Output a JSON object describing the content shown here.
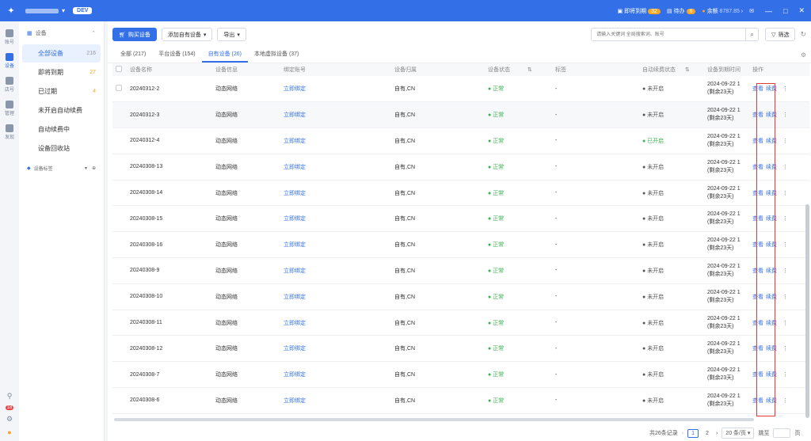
{
  "topbar": {
    "env_badge": "DEV",
    "expiring_label": "即将到期",
    "expiring_count": "32",
    "todo_label": "待办",
    "todo_count": "6",
    "balance_label": "余额",
    "balance_value": "8787.85",
    "min_btn": "—",
    "max_btn": "□",
    "close_btn": "✕"
  },
  "rail": {
    "items": [
      {
        "label": "账号"
      },
      {
        "label": "设备"
      },
      {
        "label": "店号"
      },
      {
        "label": "管理"
      },
      {
        "label": "发现"
      }
    ],
    "badge": "18"
  },
  "subnav": {
    "header": "设备",
    "items": [
      {
        "label": "全部设备",
        "count": "216"
      },
      {
        "label": "即将到期",
        "count": "27"
      },
      {
        "label": "已过期",
        "count": "4"
      },
      {
        "label": "未开启自动续费",
        "count": ""
      },
      {
        "label": "自动续费中",
        "count": ""
      },
      {
        "label": "设备回收站",
        "count": ""
      }
    ],
    "tag_label": "设备标签"
  },
  "toolbar": {
    "buy_label": "购买设备",
    "add_label": "添加自有设备",
    "export_label": "导出",
    "search_placeholder": "请输入关键词 全局搜索词、账号",
    "filter_label": "筛选"
  },
  "tabs": [
    {
      "label": "全部 (217)"
    },
    {
      "label": "平台设备 (154)"
    },
    {
      "label": "自有设备 (26)"
    },
    {
      "label": "本地虚拟设备 (37)"
    }
  ],
  "table": {
    "headers": [
      "设备名称",
      "设备信息",
      "绑定账号",
      "设备归属",
      "设备状态",
      "标签",
      "自动续费状态",
      "设备到期时间",
      "操作"
    ],
    "rows": [
      {
        "name": "20240312-2",
        "info": "动态网络",
        "bind": "立即绑定",
        "owner": "自有,CN",
        "status": "正常",
        "tag": "-",
        "renew": "未开启",
        "exp": "2024-09-22 1",
        "remain": "(剩余23天)",
        "view": "查看",
        "renew_btn": "续费"
      },
      {
        "name": "20240312-3",
        "info": "动态网络",
        "bind": "立即绑定",
        "owner": "自有,CN",
        "status": "正常",
        "tag": "-",
        "renew": "未开启",
        "exp": "2024-09-22 1",
        "remain": "(剩余23天)",
        "view": "查看",
        "renew_btn": "续费"
      },
      {
        "name": "20240312-4",
        "info": "动态网络",
        "bind": "立即绑定",
        "owner": "自有,CN",
        "status": "正常",
        "tag": "-",
        "renew": "已开启",
        "exp": "2024-09-22 1",
        "remain": "(剩余23天)",
        "view": "查看",
        "renew_btn": "续费"
      },
      {
        "name": "20240308-13",
        "info": "动态网络",
        "bind": "立即绑定",
        "owner": "自有,CN",
        "status": "正常",
        "tag": "-",
        "renew": "未开启",
        "exp": "2024-09-22 1",
        "remain": "(剩余23天)",
        "view": "查看",
        "renew_btn": "续费"
      },
      {
        "name": "20240308-14",
        "info": "动态网络",
        "bind": "立即绑定",
        "owner": "自有,CN",
        "status": "正常",
        "tag": "-",
        "renew": "未开启",
        "exp": "2024-09-22 1",
        "remain": "(剩余23天)",
        "view": "查看",
        "renew_btn": "续费"
      },
      {
        "name": "20240308-15",
        "info": "动态网络",
        "bind": "立即绑定",
        "owner": "自有,CN",
        "status": "正常",
        "tag": "-",
        "renew": "未开启",
        "exp": "2024-09-22 1",
        "remain": "(剩余23天)",
        "view": "查看",
        "renew_btn": "续费"
      },
      {
        "name": "20240308-16",
        "info": "动态网络",
        "bind": "立即绑定",
        "owner": "自有,CN",
        "status": "正常",
        "tag": "-",
        "renew": "未开启",
        "exp": "2024-09-22 1",
        "remain": "(剩余23天)",
        "view": "查看",
        "renew_btn": "续费"
      },
      {
        "name": "20240308-9",
        "info": "动态网络",
        "bind": "立即绑定",
        "owner": "自有,CN",
        "status": "正常",
        "tag": "-",
        "renew": "未开启",
        "exp": "2024-09-22 1",
        "remain": "(剩余23天)",
        "view": "查看",
        "renew_btn": "续费"
      },
      {
        "name": "20240308-10",
        "info": "动态网络",
        "bind": "立即绑定",
        "owner": "自有,CN",
        "status": "正常",
        "tag": "-",
        "renew": "未开启",
        "exp": "2024-09-22 1",
        "remain": "(剩余23天)",
        "view": "查看",
        "renew_btn": "续费"
      },
      {
        "name": "20240308-11",
        "info": "动态网络",
        "bind": "立即绑定",
        "owner": "自有,CN",
        "status": "正常",
        "tag": "-",
        "renew": "未开启",
        "exp": "2024-09-22 1",
        "remain": "(剩余23天)",
        "view": "查看",
        "renew_btn": "续费"
      },
      {
        "name": "20240308-12",
        "info": "动态网络",
        "bind": "立即绑定",
        "owner": "自有,CN",
        "status": "正常",
        "tag": "-",
        "renew": "未开启",
        "exp": "2024-09-22 1",
        "remain": "(剩余23天)",
        "view": "查看",
        "renew_btn": "续费"
      },
      {
        "name": "20240308-7",
        "info": "动态网络",
        "bind": "立即绑定",
        "owner": "自有,CN",
        "status": "正常",
        "tag": "-",
        "renew": "未开启",
        "exp": "2024-09-22 1",
        "remain": "(剩余23天)",
        "view": "查看",
        "renew_btn": "续费"
      },
      {
        "name": "20240308-6",
        "info": "动态网络",
        "bind": "立即绑定",
        "owner": "自有,CN",
        "status": "正常",
        "tag": "-",
        "renew": "未开启",
        "exp": "2024-09-22 1",
        "remain": "(剩余23天)",
        "view": "查看",
        "renew_btn": "续费"
      }
    ]
  },
  "pager": {
    "total": "共26条记录",
    "page1": "1",
    "page2": "2",
    "size": "20 条/页",
    "jump_label": "跳至",
    "page_suffix": "页"
  },
  "colors": {
    "accent": "#3370e8",
    "ok": "#37b24d",
    "highlight_box": "#e53935"
  }
}
